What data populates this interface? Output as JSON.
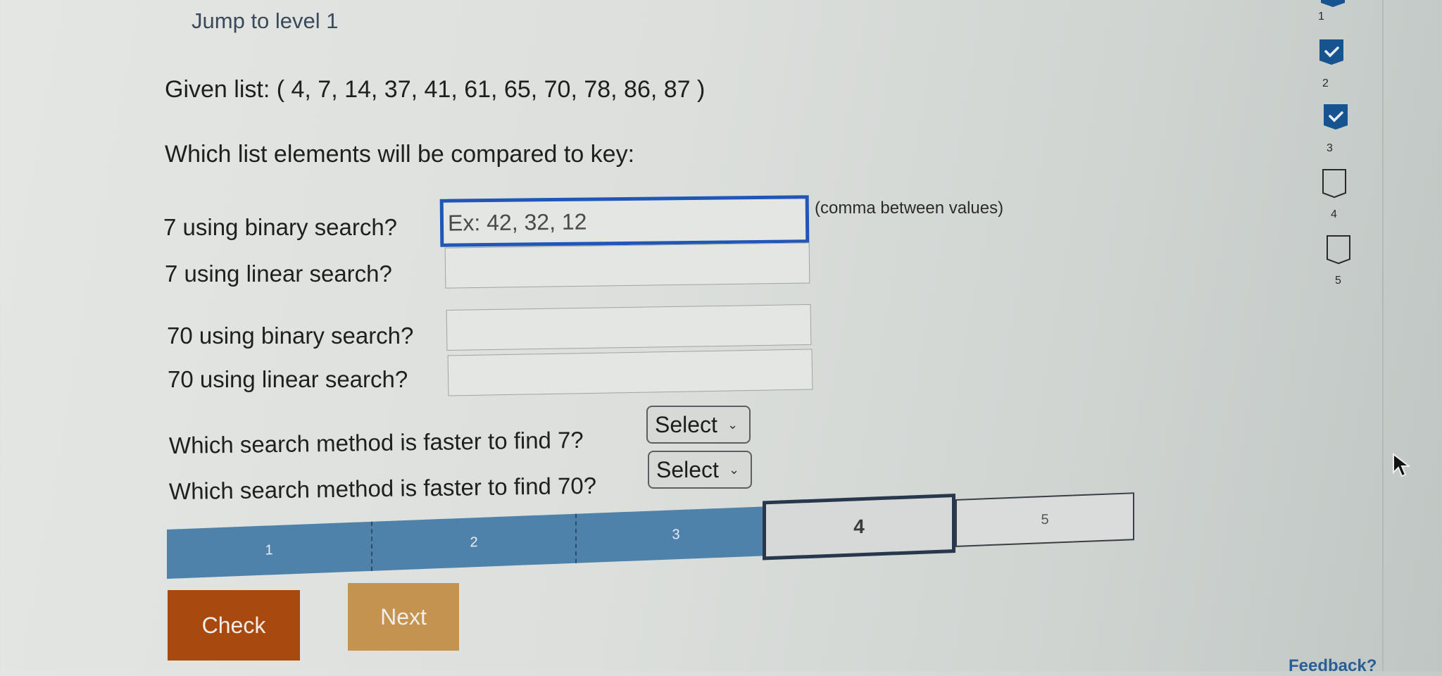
{
  "header": {
    "jump_label": "Jump to level 1"
  },
  "problem": {
    "given_list_label": "Given list: ( 4, 7, 14, 37, 41, 61, 65, 70, 78, 86, 87 )",
    "prompt": "Which list elements will be compared to key:",
    "hint": "(comma between values)",
    "questions": [
      {
        "label": "7 using binary search?",
        "value": "",
        "placeholder": "Ex: 42, 32, 12",
        "focused": true
      },
      {
        "label": "7 using linear search?",
        "value": "",
        "placeholder": ""
      },
      {
        "label": "70 using binary search?",
        "value": "",
        "placeholder": ""
      },
      {
        "label": "70 using linear search?",
        "value": "",
        "placeholder": ""
      }
    ],
    "faster_questions": [
      {
        "label": "Which search method is faster to find 7?",
        "selected": "Select"
      },
      {
        "label": "Which search method is faster to find 70?",
        "selected": "Select"
      }
    ]
  },
  "progress": {
    "segments": [
      {
        "label": "1",
        "state": "done"
      },
      {
        "label": "2",
        "state": "done"
      },
      {
        "label": "3",
        "state": "done"
      },
      {
        "label": "4",
        "state": "current"
      },
      {
        "label": "5",
        "state": "todo"
      }
    ]
  },
  "buttons": {
    "check": "Check",
    "next": "Next"
  },
  "sidebar": {
    "levels": [
      {
        "label": "1",
        "completed": true
      },
      {
        "label": "2",
        "completed": true
      },
      {
        "label": "3",
        "completed": true
      },
      {
        "label": "4",
        "completed": false
      },
      {
        "label": "5",
        "completed": false
      }
    ]
  },
  "footer": {
    "feedback": "Feedback?"
  },
  "colors": {
    "accent_blue": "#1f56b8",
    "progress_done": "#4f82ab",
    "check_button": "#a8490f",
    "next_button": "#c4934f",
    "badge_done": "#17548f"
  }
}
